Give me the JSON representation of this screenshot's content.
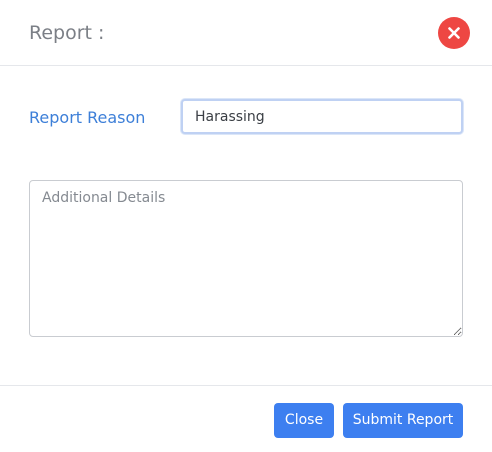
{
  "modal": {
    "title": "Report :",
    "close_icon": "close-icon",
    "accent_color": "#3d7ff0",
    "danger_color": "#ee4743"
  },
  "form": {
    "reason_label": "Report Reason",
    "reason_value": "Harassing",
    "details_placeholder": "Additional Details",
    "details_value": ""
  },
  "footer": {
    "close_label": "Close",
    "submit_label": "Submit Report"
  }
}
